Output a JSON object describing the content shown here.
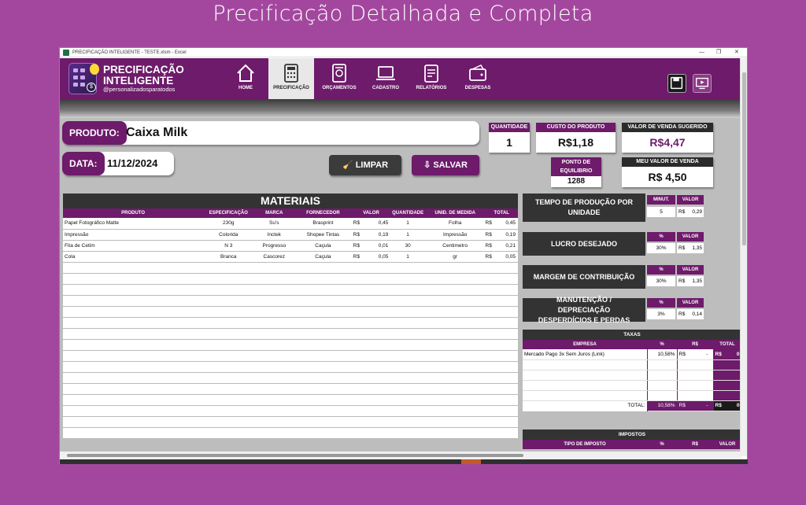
{
  "banner": "Precificação Detalhada e Completa",
  "window": {
    "title": "PRECIFICAÇÃO INTELIGENTE - TESTE.xlsm - Excel"
  },
  "logo": {
    "line1": "PRECIFICAÇÃO",
    "line2": "INTELIGENTE",
    "handle": "@personalizadosparatodos"
  },
  "nav": [
    {
      "label": "HOME",
      "icon": "home-icon"
    },
    {
      "label": "PRECIFICAÇÃO",
      "icon": "calculator-icon",
      "active": true
    },
    {
      "label": "ORÇAMENTOS",
      "icon": "document-icon"
    },
    {
      "label": "CADASTRO",
      "icon": "laptop-icon"
    },
    {
      "label": "RELATÓRIOS",
      "icon": "report-icon"
    },
    {
      "label": "DESPESAS",
      "icon": "wallet-icon"
    }
  ],
  "produto": {
    "label": "PRODUTO:",
    "value": "Caixa Milk"
  },
  "data": {
    "label": "DATA:",
    "value": "11/12/2024"
  },
  "buttons": {
    "limpar": "LIMPAR",
    "salvar": "SALVAR"
  },
  "quantidade": {
    "label": "QUANTIDADE",
    "value": "1"
  },
  "custo": {
    "label": "CUSTO DO PRODUTO",
    "value": "R$1,18"
  },
  "venda_sugerido": {
    "label": "VALOR DE VENDA SUGERIDO",
    "value": "R$4,47"
  },
  "ponto_equilibrio": {
    "label1": "PONTO DE",
    "label2": "EQUILIBRIO",
    "value": "1288"
  },
  "meu_valor": {
    "label": "MEU VALOR DE VENDA",
    "value": "R$ 4,50"
  },
  "materiais": {
    "title": "MATERIAIS",
    "headers": [
      "PRODUTO",
      "ESPECIFICAÇÃO",
      "MARCA",
      "FORNECEDOR",
      "VALOR",
      "QUANTIDADE",
      "UNID. DE MEDIDA",
      "TOTAL"
    ],
    "rows": [
      {
        "produto": "Papel Fotográfico Matte",
        "espec": "230g",
        "marca": "Su's",
        "fornecedor": "Brasprint",
        "valor": "0,45",
        "qtd": "1",
        "unid": "Folha",
        "total": "0,45"
      },
      {
        "produto": "Impressão",
        "espec": "Colorida",
        "marca": "Inctek",
        "fornecedor": "Shopee Tintas",
        "valor": "0,19",
        "qtd": "1",
        "unid": "Impressão",
        "total": "0,19"
      },
      {
        "produto": "Fita de Cetim",
        "espec": "N 3",
        "marca": "Progresso",
        "fornecedor": "Caçula",
        "valor": "0,01",
        "qtd": "30",
        "unid": "Centimetro",
        "total": "0,21"
      },
      {
        "produto": "Cola",
        "espec": "Branca",
        "marca": "Cascorez",
        "fornecedor": "Caçula",
        "valor": "0,05",
        "qtd": "1",
        "unid": "gr",
        "total": "0,05"
      }
    ],
    "currency": "R$"
  },
  "tempo": {
    "label": "TEMPO DE PRODUÇÃO POR UNIDADE",
    "h1": "MINUT.",
    "h2": "VALOR",
    "v1": "5",
    "v2": "0,29"
  },
  "lucro": {
    "label": "LUCRO DESEJADO",
    "h1": "%",
    "h2": "VALOR",
    "v1": "30%",
    "v2": "1,35"
  },
  "margem": {
    "label": "MARGEM DE CONTRIBUIÇÃO",
    "h1": "%",
    "h2": "VALOR",
    "v1": "30%",
    "v2": "1,35"
  },
  "manutencao": {
    "label": "MANUTENÇÃO / DEPRECIAÇÃO DESPERDÍCIOS E PERDAS",
    "h1": "%",
    "h2": "VALOR",
    "v1": "3%",
    "v2": "0,14"
  },
  "taxas": {
    "title": "TAXAS",
    "headers": [
      "EMPRESA",
      "%",
      "R$",
      "TOTAL"
    ],
    "row": {
      "empresa": "Mercado Pago 3x Sem Juros (Link)",
      "pct": "10,58%",
      "rs": "-",
      "total": "0"
    },
    "total_label": "TOTAL:",
    "total_pct": "10,58%",
    "total_rs": "-",
    "total_val": "0"
  },
  "impostos": {
    "title": "IMPOSTOS",
    "headers": [
      "TIPO DE IMPOSTO",
      "%",
      "R$",
      "VALOR"
    ]
  }
}
